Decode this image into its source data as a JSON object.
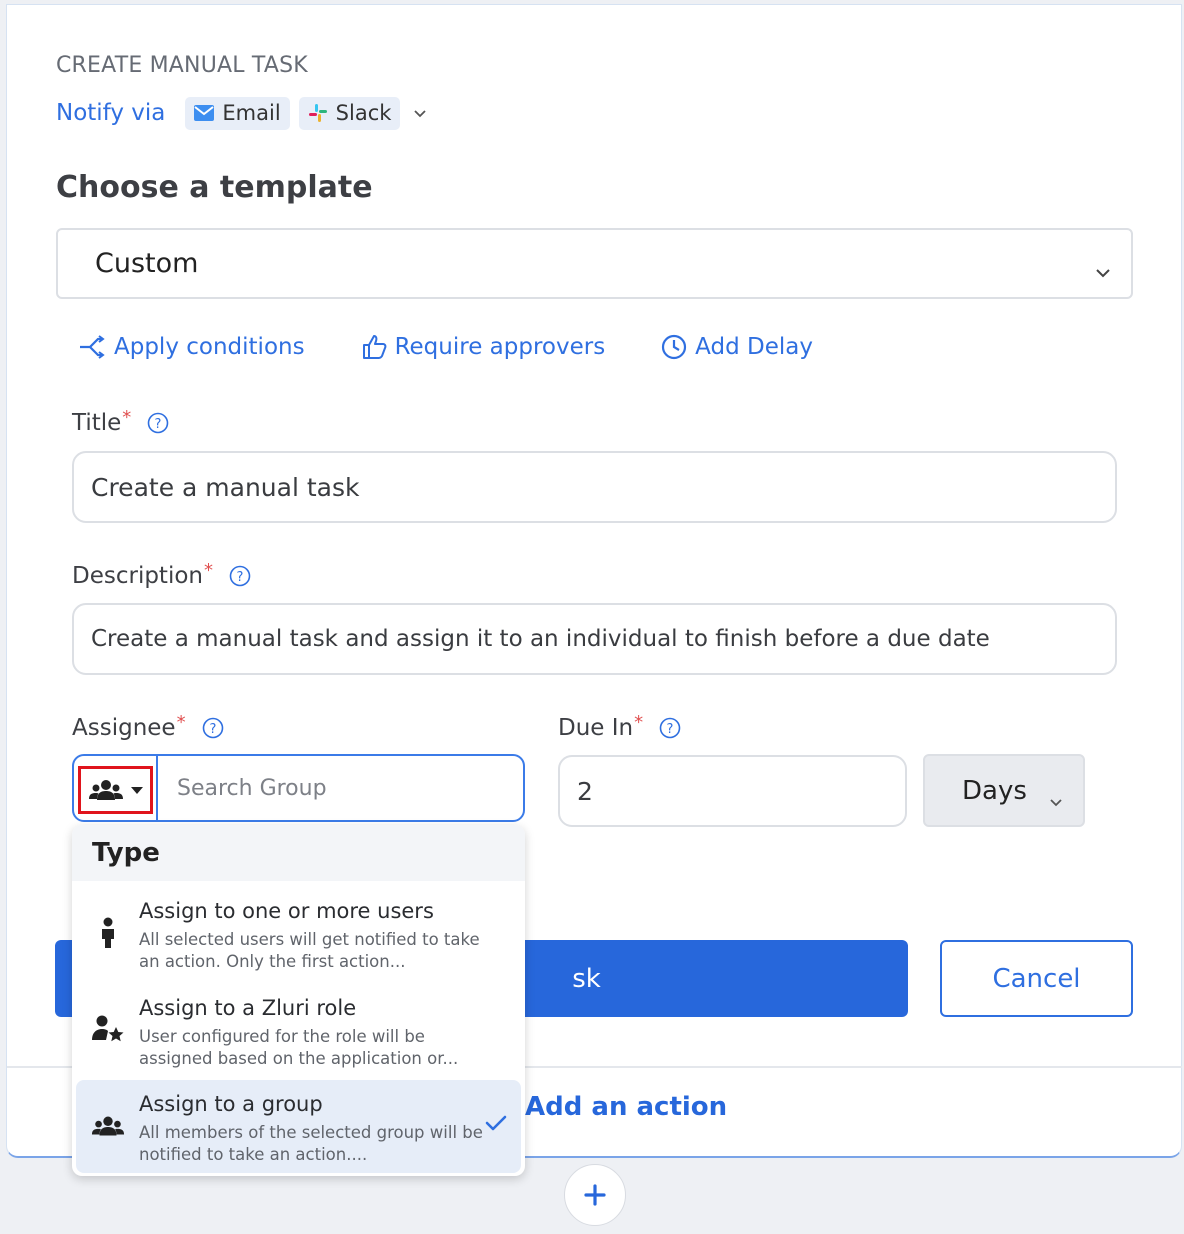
{
  "section": {
    "label": "CREATE MANUAL TASK"
  },
  "notify": {
    "label": "Notify via",
    "channels": [
      {
        "label": "Email",
        "icon": "email-icon"
      },
      {
        "label": "Slack",
        "icon": "slack-icon"
      }
    ]
  },
  "template": {
    "heading": "Choose a template",
    "selected": "Custom"
  },
  "options": {
    "conditions": "Apply conditions",
    "approvers": "Require approvers",
    "delay": "Add Delay"
  },
  "fields": {
    "title": {
      "label": "Title",
      "required_mark": "*",
      "value": "Create a manual task"
    },
    "description": {
      "label": "Description",
      "required_mark": "*",
      "value": "Create a manual task and assign it to an individual to finish before a due date"
    },
    "assignee": {
      "label": "Assignee",
      "required_mark": "*",
      "placeholder": "Search Group"
    },
    "due_in": {
      "label": "Due In",
      "required_mark": "*",
      "value": "2",
      "unit": "Days"
    }
  },
  "dropdown": {
    "header": "Type",
    "items": [
      {
        "title": "Assign to one or more users",
        "desc": "All selected users will get notified to take an action. Only the first action...",
        "icon": "user-icon",
        "selected": false
      },
      {
        "title": "Assign to a Zluri role",
        "desc": "User configured for the role will be assigned based on the application or...",
        "icon": "user-star-icon",
        "selected": false
      },
      {
        "title": "Assign to a group",
        "desc": "All members of the selected group will be notified to take an action....",
        "icon": "group-icon",
        "selected": true
      }
    ]
  },
  "buttons": {
    "create_visible_fragment": "sk",
    "cancel": "Cancel"
  },
  "footer": {
    "add_action": "Add an action"
  },
  "colors": {
    "accent": "#2767db",
    "link": "#2f6fe0",
    "highlight": "#e0141c"
  }
}
